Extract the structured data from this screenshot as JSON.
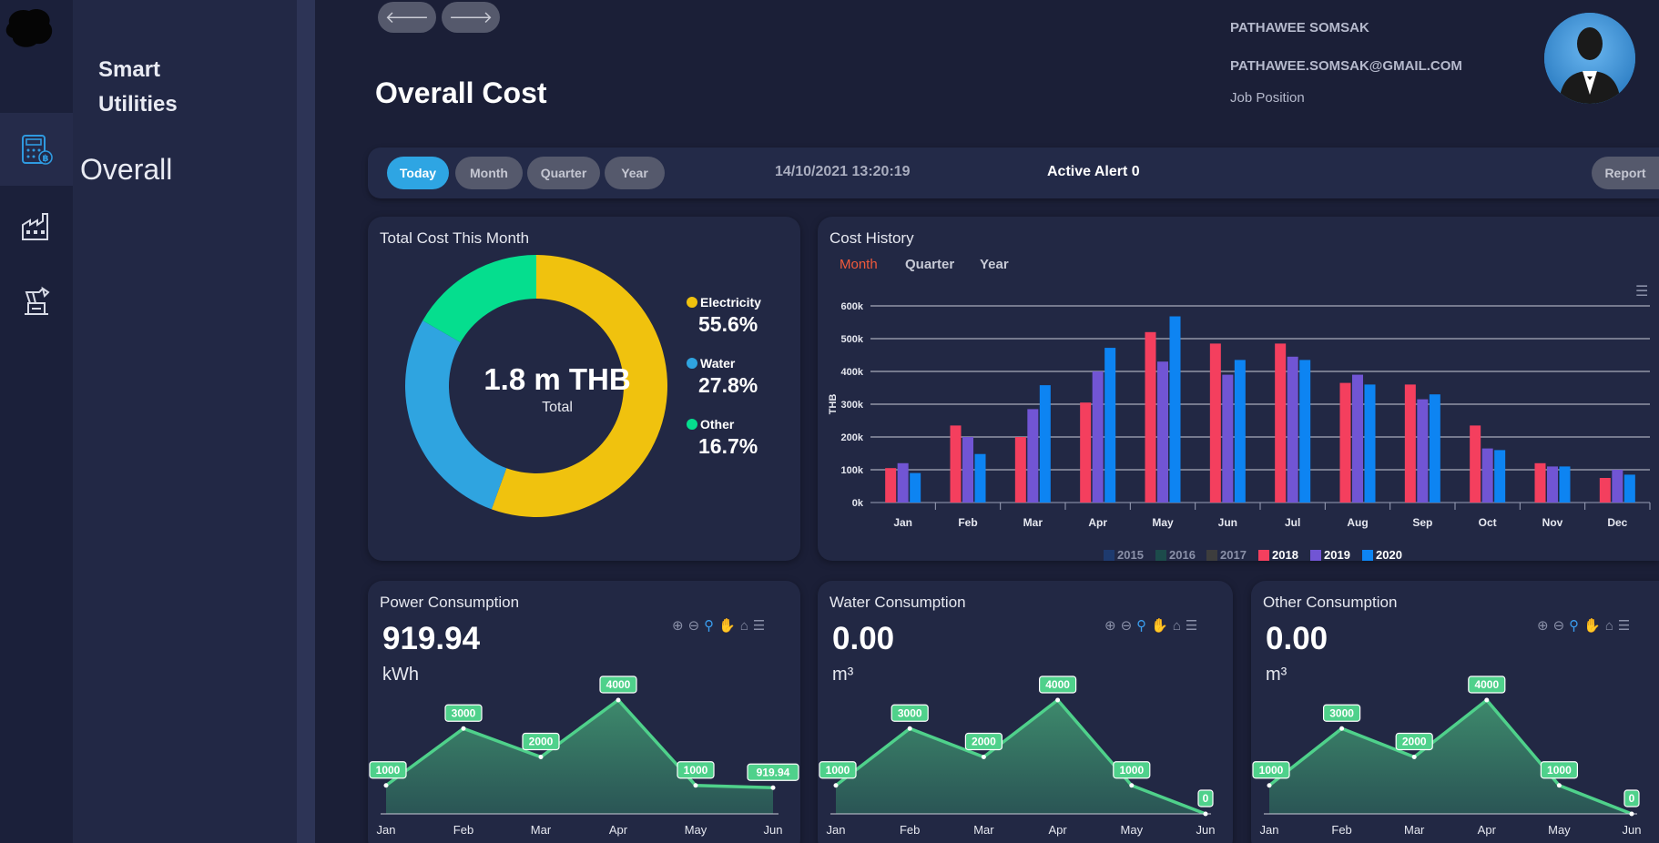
{
  "app": {
    "brand_line1": "Smart",
    "brand_line2": "Utilities"
  },
  "rail": {
    "items": [
      {
        "icon": "calculator-baht-icon",
        "active": true
      },
      {
        "icon": "factory-icon",
        "active": false
      },
      {
        "icon": "machine-icon",
        "active": false
      }
    ]
  },
  "sidenav": {
    "selected_label": "Overall"
  },
  "header": {
    "back_icon": "arrow-left-icon",
    "forward_icon": "arrow-right-icon",
    "title": "Overall Cost",
    "user_name": "PATHAWEE SOMSAK",
    "user_email": "PATHAWEE.SOMSAK@GMAIL.COM",
    "user_job": "Job Position"
  },
  "toolbar": {
    "periods": [
      "Today",
      "Month",
      "Quarter",
      "Year"
    ],
    "active_period": "Today",
    "datetime": "14/10/2021 13:20:19",
    "alert": "Active Alert 0",
    "report_label": "Report"
  },
  "colors": {
    "electricity": "#f0c20e",
    "water": "#2fa4e0",
    "other": "#05de8e",
    "y2015": "#1e3a6e",
    "y2016": "#1c4b4b",
    "y2017": "#3d3d3d",
    "y2018": "#f43f5e",
    "y2019": "#7155d4",
    "y2020": "#0d84f2",
    "line": "#4fd18b"
  },
  "total_cost": {
    "title": "Total Cost This Month",
    "center_value": "1.8 m THB",
    "center_label": "Total",
    "legend": [
      {
        "name": "Electricity",
        "pct": "55.6%"
      },
      {
        "name": "Water",
        "pct": "27.8%"
      },
      {
        "name": "Other",
        "pct": "16.7%"
      }
    ]
  },
  "cost_history": {
    "title": "Cost History",
    "tabs": [
      "Month",
      "Quarter",
      "Year"
    ],
    "active_tab": "Month",
    "menu_icon": "hamburger-menu-icon"
  },
  "consumption": [
    {
      "title": "Power Consumption",
      "value": "919.94",
      "unit": "kWh"
    },
    {
      "title": "Water Consumption",
      "value": "0.00",
      "unit": "m³"
    },
    {
      "title": "Other Consumption",
      "value": "0.00",
      "unit": "m³"
    }
  ],
  "chart_tools_icons": [
    "zoom-in-icon",
    "zoom-out-icon",
    "magnify-icon",
    "pan-hand-icon",
    "home-icon",
    "menu-icon"
  ],
  "chart_data": [
    {
      "type": "pie",
      "title": "Total Cost This Month",
      "categories": [
        "Electricity",
        "Water",
        "Other"
      ],
      "values": [
        55.6,
        27.8,
        16.7
      ]
    },
    {
      "type": "bar",
      "title": "Cost History",
      "categories": [
        "Jan",
        "Feb",
        "Mar",
        "Apr",
        "May",
        "Jun",
        "Jul",
        "Aug",
        "Sep",
        "Oct",
        "Nov",
        "Dec"
      ],
      "ylabel": "THB",
      "ylim": [
        0,
        600000
      ],
      "yticks": [
        "0k",
        "100k",
        "200k",
        "300k",
        "400k",
        "500k",
        "600k"
      ],
      "legend": [
        "2015",
        "2016",
        "2017",
        "2018",
        "2019",
        "2020"
      ],
      "series": [
        {
          "name": "2015",
          "values": []
        },
        {
          "name": "2016",
          "values": []
        },
        {
          "name": "2017",
          "values": []
        },
        {
          "name": "2018",
          "values": [
            105000,
            235000,
            200000,
            305000,
            520000,
            485000,
            485000,
            365000,
            360000,
            235000,
            120000,
            75000
          ]
        },
        {
          "name": "2019",
          "values": [
            120000,
            200000,
            285000,
            400000,
            430000,
            390000,
            445000,
            390000,
            315000,
            165000,
            110000,
            100000
          ]
        },
        {
          "name": "2020",
          "values": [
            90000,
            148000,
            358000,
            472000,
            568000,
            435000,
            435000,
            360000,
            330000,
            160000,
            110000,
            85000
          ]
        }
      ],
      "legend_position": "bottom"
    },
    {
      "type": "area",
      "title": "Power Consumption",
      "categories": [
        "Jan",
        "Feb",
        "Mar",
        "Apr",
        "May",
        "Jun"
      ],
      "values": [
        1000,
        3000,
        2000,
        4000,
        1000,
        919.94
      ],
      "labels": [
        "1000",
        "3000",
        "2000",
        "4000",
        "1000",
        "919.94"
      ]
    },
    {
      "type": "area",
      "title": "Water Consumption",
      "categories": [
        "Jan",
        "Feb",
        "Mar",
        "Apr",
        "May",
        "Jun"
      ],
      "values": [
        1000,
        3000,
        2000,
        4000,
        1000,
        0
      ],
      "labels": [
        "1000",
        "3000",
        "2000",
        "4000",
        "1000",
        "0"
      ]
    },
    {
      "type": "area",
      "title": "Other Consumption",
      "categories": [
        "Jan",
        "Feb",
        "Mar",
        "Apr",
        "May",
        "Jun"
      ],
      "values": [
        1000,
        3000,
        2000,
        4000,
        1000,
        0
      ],
      "labels": [
        "1000",
        "3000",
        "2000",
        "4000",
        "1000",
        "0"
      ]
    }
  ]
}
